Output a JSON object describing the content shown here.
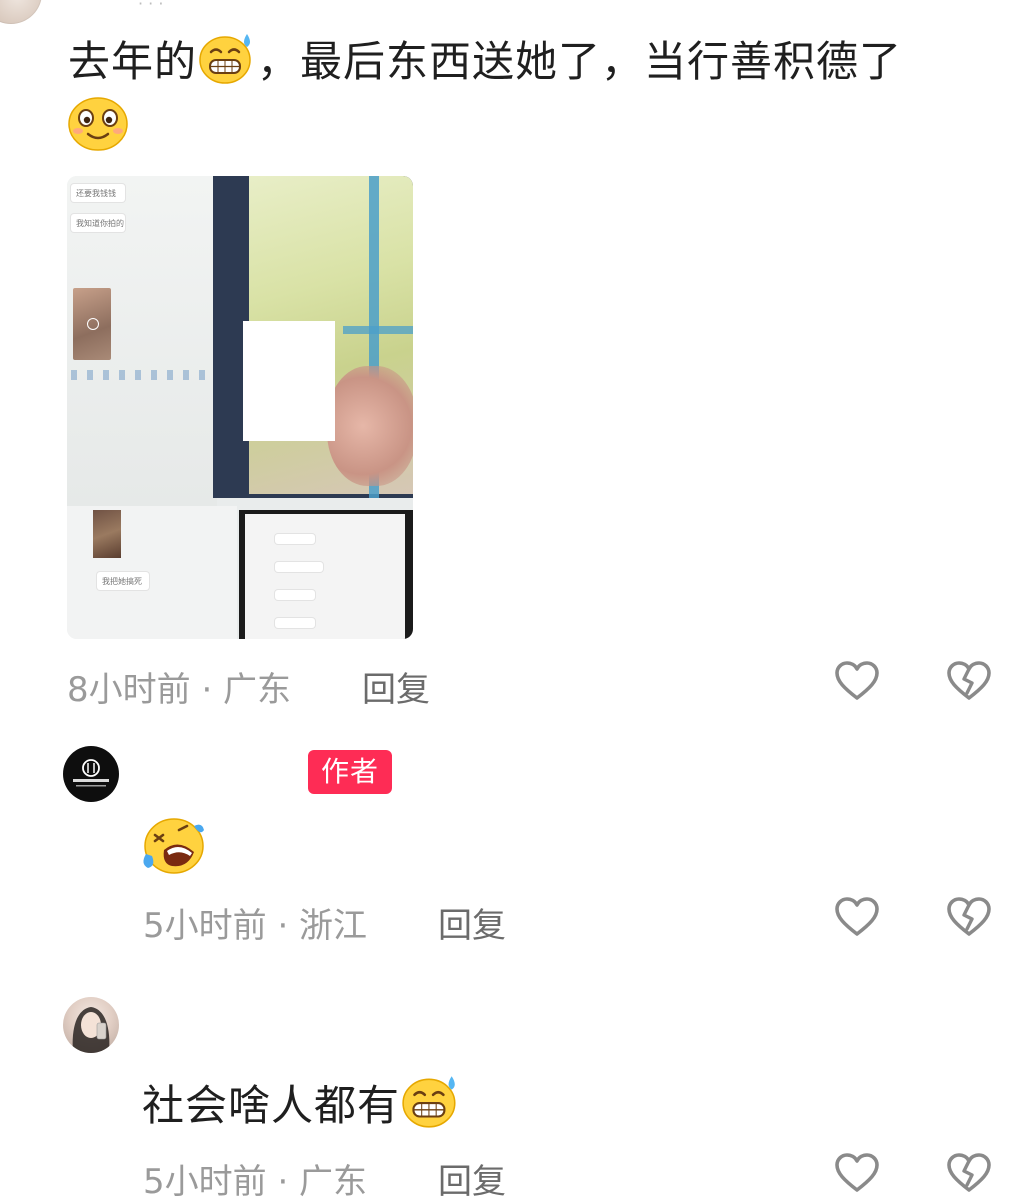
{
  "comments": [
    {
      "text": "去年的",
      "text_after_emoji": "，最后东西送她了，当行善积德了",
      "emojis": [
        "grimace-sweat-emoji",
        "smile-emoji"
      ],
      "has_image": true,
      "image_bubbles": [
        "还要我钱钱",
        "我知道你拍的",
        "我把她搞死"
      ],
      "time": "8小时前 · 广东",
      "reply_label": "回复"
    },
    {
      "author_badge": "作者",
      "emojis": [
        "rolling-laugh-emoji"
      ],
      "time": "5小时前 · 浙江",
      "reply_label": "回复"
    },
    {
      "text": "社会啥人都有",
      "emojis": [
        "grimace-sweat-emoji"
      ],
      "time": "5小时前 · 广东",
      "reply_label": "回复"
    }
  ],
  "colors": {
    "badge": "#fe2c55",
    "meta": "#9a9a9a",
    "reply": "#6b6b6b",
    "icon": "#8a8a8a"
  }
}
